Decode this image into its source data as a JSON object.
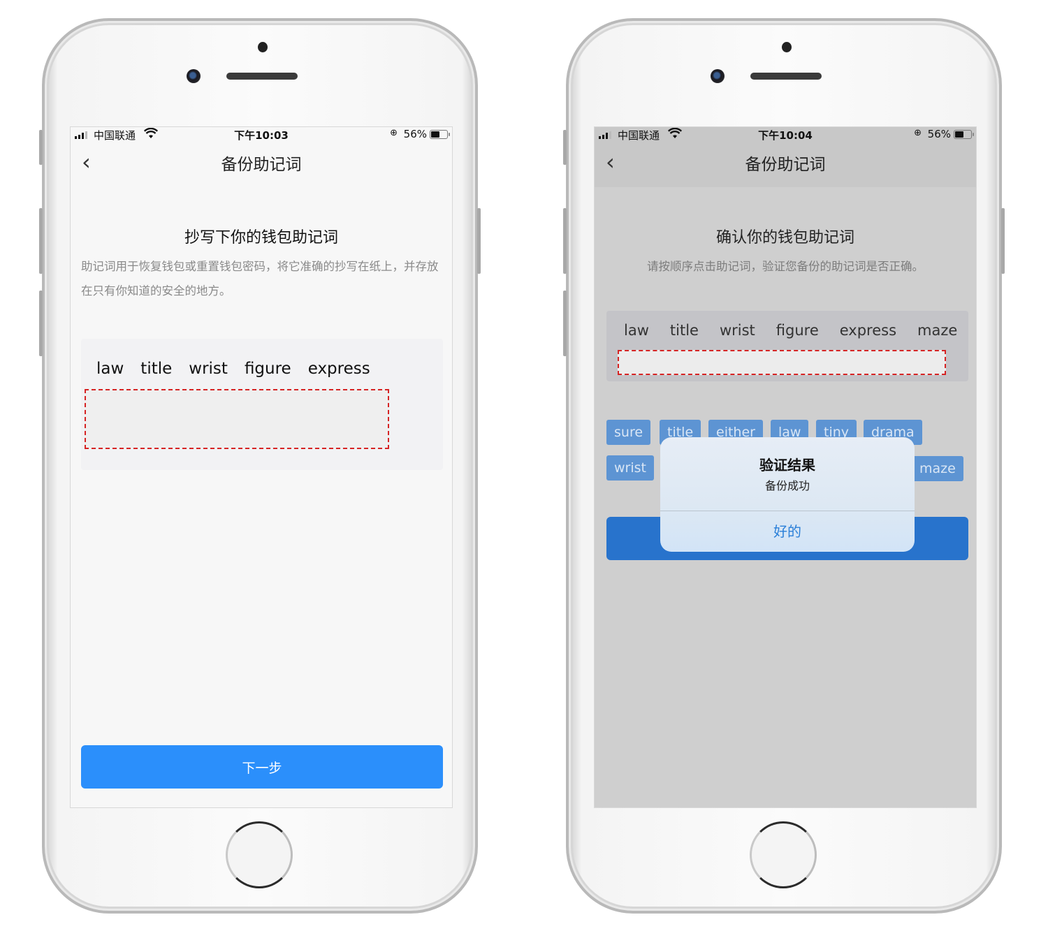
{
  "left_phone": {
    "status_bar": {
      "carrier": "中国联通",
      "time": "下午10:03",
      "battery_percent": "56%",
      "battery_level": 0.56
    },
    "nav": {
      "back_icon": "chevron-left-icon",
      "title": "备份助记词"
    },
    "heading": "抄写下你的钱包助记词",
    "description": "助记词用于恢复钱包或重置钱包密码，将它准确的抄写在纸上，并存放在只有你知道的安全的地方。",
    "mnemonic_words": [
      "law",
      "title",
      "wrist",
      "figure",
      "express"
    ],
    "next_button": "下一步"
  },
  "right_phone": {
    "status_bar": {
      "carrier": "中国联通",
      "time": "下午10:04",
      "battery_percent": "56%",
      "battery_level": 0.56
    },
    "nav": {
      "back_icon": "chevron-left-icon",
      "title": "备份助记词"
    },
    "heading": "确认你的钱包助记词",
    "description": "请按顺序点击助记词，验证您备份的助记词是否正确。",
    "selected_words": [
      "law",
      "title",
      "wrist",
      "figure",
      "express",
      "maze"
    ],
    "word_chips_row1": [
      "sure",
      "title",
      "either",
      "law",
      "tiny",
      "drama"
    ],
    "word_chips_row2": [
      "wrist",
      "maze"
    ],
    "alert": {
      "title": "验证结果",
      "message": "备份成功",
      "ok_button": "好的"
    }
  }
}
